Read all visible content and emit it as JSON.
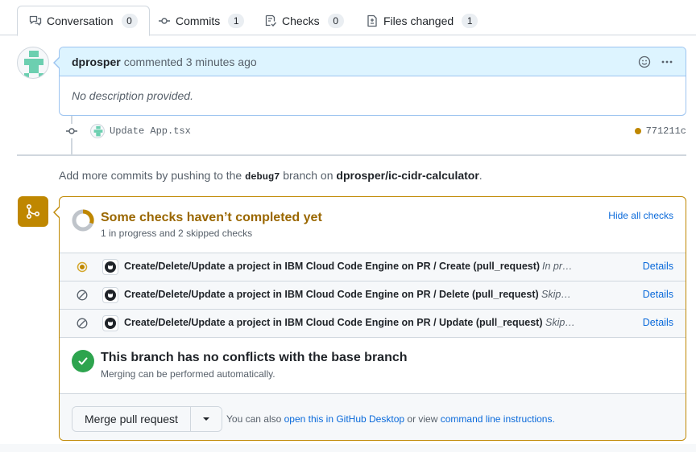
{
  "tabs": [
    {
      "label": "Conversation",
      "count": "0",
      "icon": "comment-discussion-icon"
    },
    {
      "label": "Commits",
      "count": "1",
      "icon": "git-commit-icon"
    },
    {
      "label": "Checks",
      "count": "0",
      "icon": "checklist-icon"
    },
    {
      "label": "Files changed",
      "count": "1",
      "icon": "file-diff-icon"
    }
  ],
  "comment": {
    "author": "dprosper",
    "meta": "commented 3 minutes ago",
    "body": "No description provided."
  },
  "commit": {
    "message": "Update App.tsx",
    "sha": "771211c",
    "status_color": "#bf8700"
  },
  "hint": {
    "prefix": "Add more commits by pushing to the",
    "branch": "debug7",
    "middle": "branch on",
    "repo": "dprosper/ic-cidr-calculator",
    "suffix": "."
  },
  "checks": {
    "title": "Some checks haven’t completed yet",
    "subtitle": "1 in progress and 2 skipped checks",
    "toggle_label": "Hide all checks",
    "rows": [
      {
        "name": "Create/Delete/Update a project in IBM Cloud Code Engine on PR / Create (pull_request)",
        "state": "In pr…",
        "details": "Details",
        "status": "in-progress"
      },
      {
        "name": "Create/Delete/Update a project in IBM Cloud Code Engine on PR / Delete (pull_request)",
        "state": "Skip…",
        "details": "Details",
        "status": "skipped"
      },
      {
        "name": "Create/Delete/Update a project in IBM Cloud Code Engine on PR / Update (pull_request)",
        "state": "Skip…",
        "details": "Details",
        "status": "skipped"
      }
    ]
  },
  "conflicts": {
    "title": "This branch has no conflicts with the base branch",
    "subtitle": "Merging can be performed automatically."
  },
  "merge": {
    "button_label": "Merge pull request",
    "note_prefix": "You can also",
    "desktop_link": "open this in GitHub Desktop",
    "note_middle": "or view",
    "cli_link": "command line instructions",
    "note_suffix": "."
  },
  "colors": {
    "pending": "#bf8700",
    "success": "#2da44e",
    "link": "#0969da"
  }
}
